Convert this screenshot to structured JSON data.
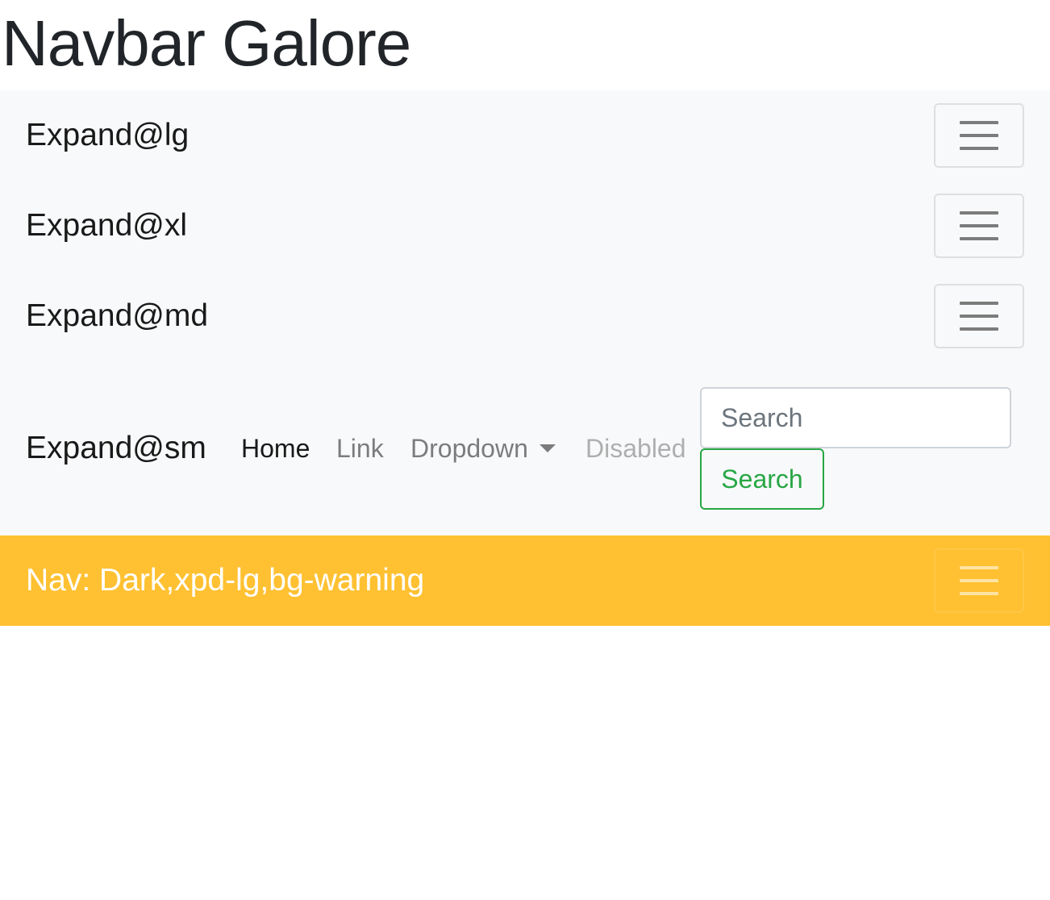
{
  "page": {
    "title": "Navbar Galore"
  },
  "navbars": {
    "lg": {
      "brand": "Expand@lg"
    },
    "xl": {
      "brand": "Expand@xl"
    },
    "md": {
      "brand": "Expand@md"
    },
    "sm": {
      "brand": "Expand@sm",
      "links": [
        {
          "label": "Home",
          "state": "active"
        },
        {
          "label": "Link",
          "state": "normal"
        },
        {
          "label": "Dropdown",
          "state": "dropdown"
        },
        {
          "label": "Disabled",
          "state": "disabled"
        }
      ],
      "search": {
        "placeholder": "Search",
        "button_label": "Search"
      }
    },
    "warning": {
      "brand": "Nav: Dark,xpd-lg,bg-warning"
    }
  },
  "icons": {
    "toggler": "hamburger-menu-icon",
    "dropdown": "caret-down-icon"
  },
  "colors": {
    "navbar_light_bg": "#f8f9fa",
    "navbar_warning_bg": "#ffc132",
    "success": "#28a745",
    "text": "#212529"
  }
}
